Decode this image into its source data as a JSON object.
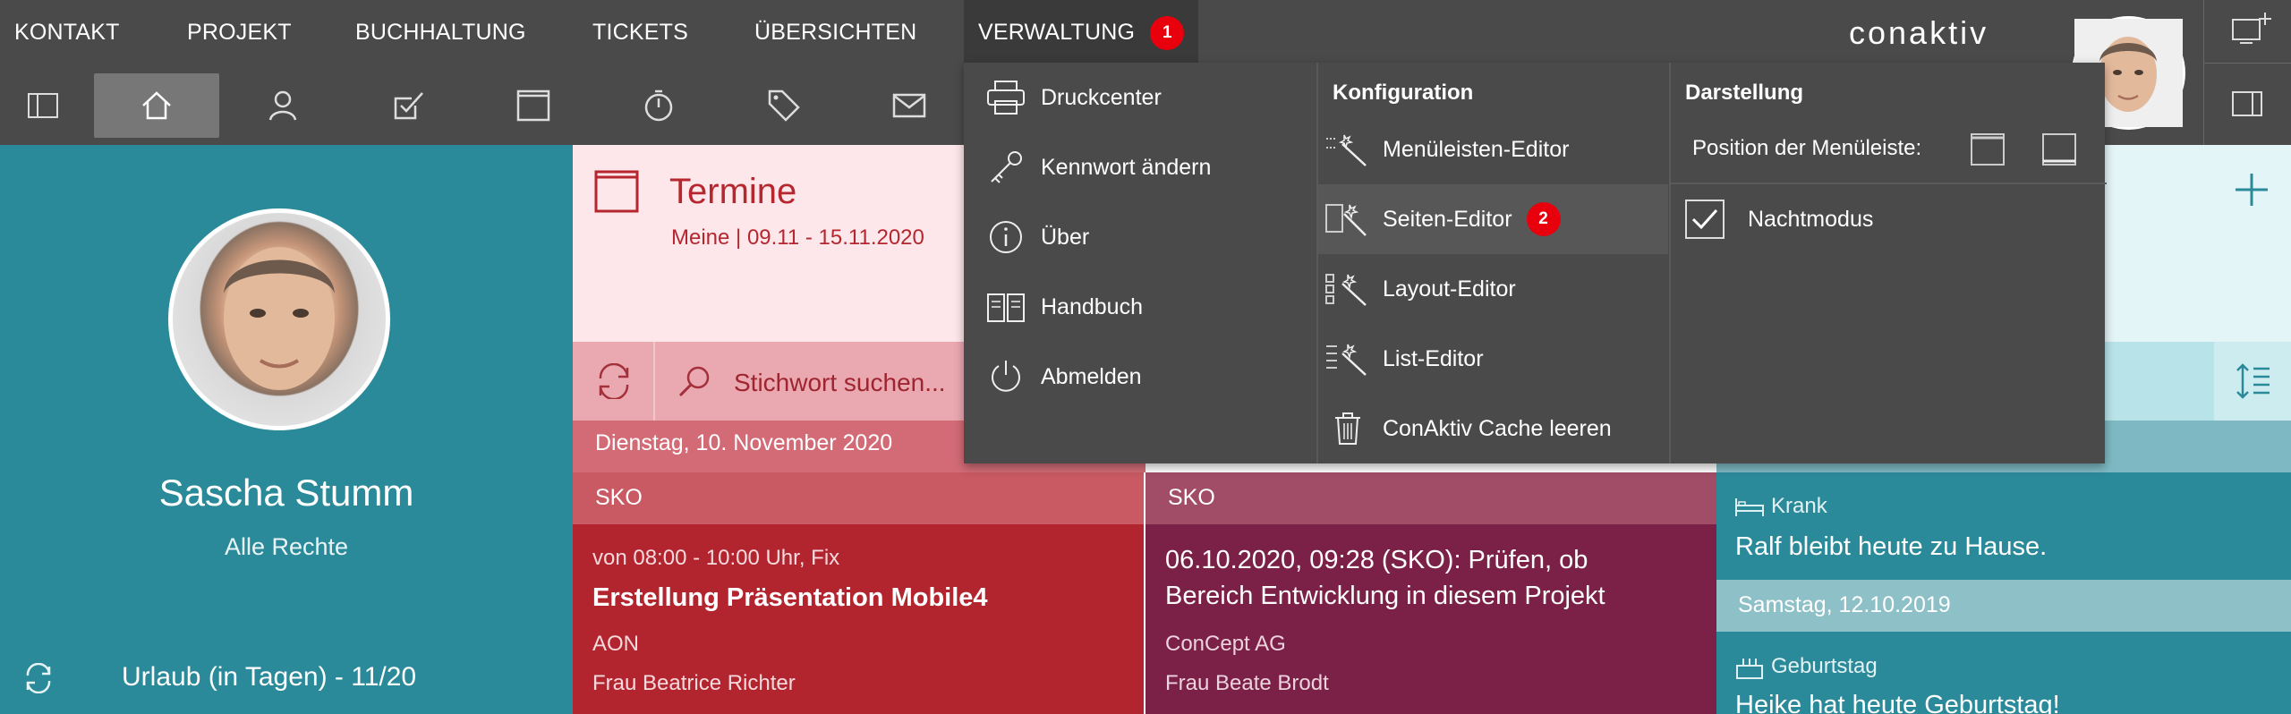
{
  "topnav": {
    "items": [
      "KONTAKT",
      "PROJEKT",
      "BUCHHALTUNG",
      "TICKETS",
      "ÜBERSICHTEN"
    ],
    "active": "VERWALTUNG",
    "active_badge": "1",
    "logo": "conaktiv"
  },
  "toolbar": {
    "icons": [
      "sidebar-toggle-icon",
      "home-icon",
      "person-icon",
      "task-icon",
      "calendar-icon",
      "timer-icon",
      "tag-icon",
      "mail-icon"
    ]
  },
  "dropdown": {
    "col1": [
      "Druckcenter",
      "Kennwort ändern",
      "Über",
      "Handbuch",
      "Abmelden"
    ],
    "col2_header": "Konfiguration",
    "col2": [
      "Menüleisten-Editor",
      "Seiten-Editor",
      "Layout-Editor",
      "List-Editor",
      "ConAktiv Cache leeren"
    ],
    "col2_badge": "2",
    "col3_header": "Darstellung",
    "menu_position_label": "Position der Menüleiste:",
    "night_mode_label": "Nachtmodus",
    "night_mode_checked": true
  },
  "profile": {
    "name": "Sascha Stumm",
    "role": "Alle Rechte",
    "vacation": "Urlaub (in Tagen) - 11/20"
  },
  "termine": {
    "title": "Termine",
    "subtitle": "Meine | 09.11 - 15.11.2020",
    "search_placeholder": "Stichwort suchen...",
    "date": "Dienstag, 10. November 2020",
    "group1": "SKO",
    "group2": "SKO",
    "card1": {
      "time": "von 08:00 - 10:00 Uhr, Fix",
      "title": "Erstellung Präsentation Mobile4",
      "company": "AON",
      "person": "Frau Beatrice Richter"
    },
    "card2": {
      "title_line1": "06.10.2020, 09:28 (SKO): Prüfen, ob",
      "title_line2": "Bereich Entwicklung in diesem Projekt",
      "company": "ConCept AG",
      "person": "Frau Beate Brodt"
    }
  },
  "right_panel": {
    "item1_type": "Krank",
    "item1_text": "Ralf bleibt heute zu Hause.",
    "date2": "Samstag, 12.10.2019",
    "item2_type": "Geburtstag",
    "item2_text": "Heike hat heute Geburtstag!"
  },
  "colors": {
    "bar": "#4a4a4a",
    "teal": "#2b8a99",
    "red": "#b2252f",
    "badge": "#e8000d"
  }
}
